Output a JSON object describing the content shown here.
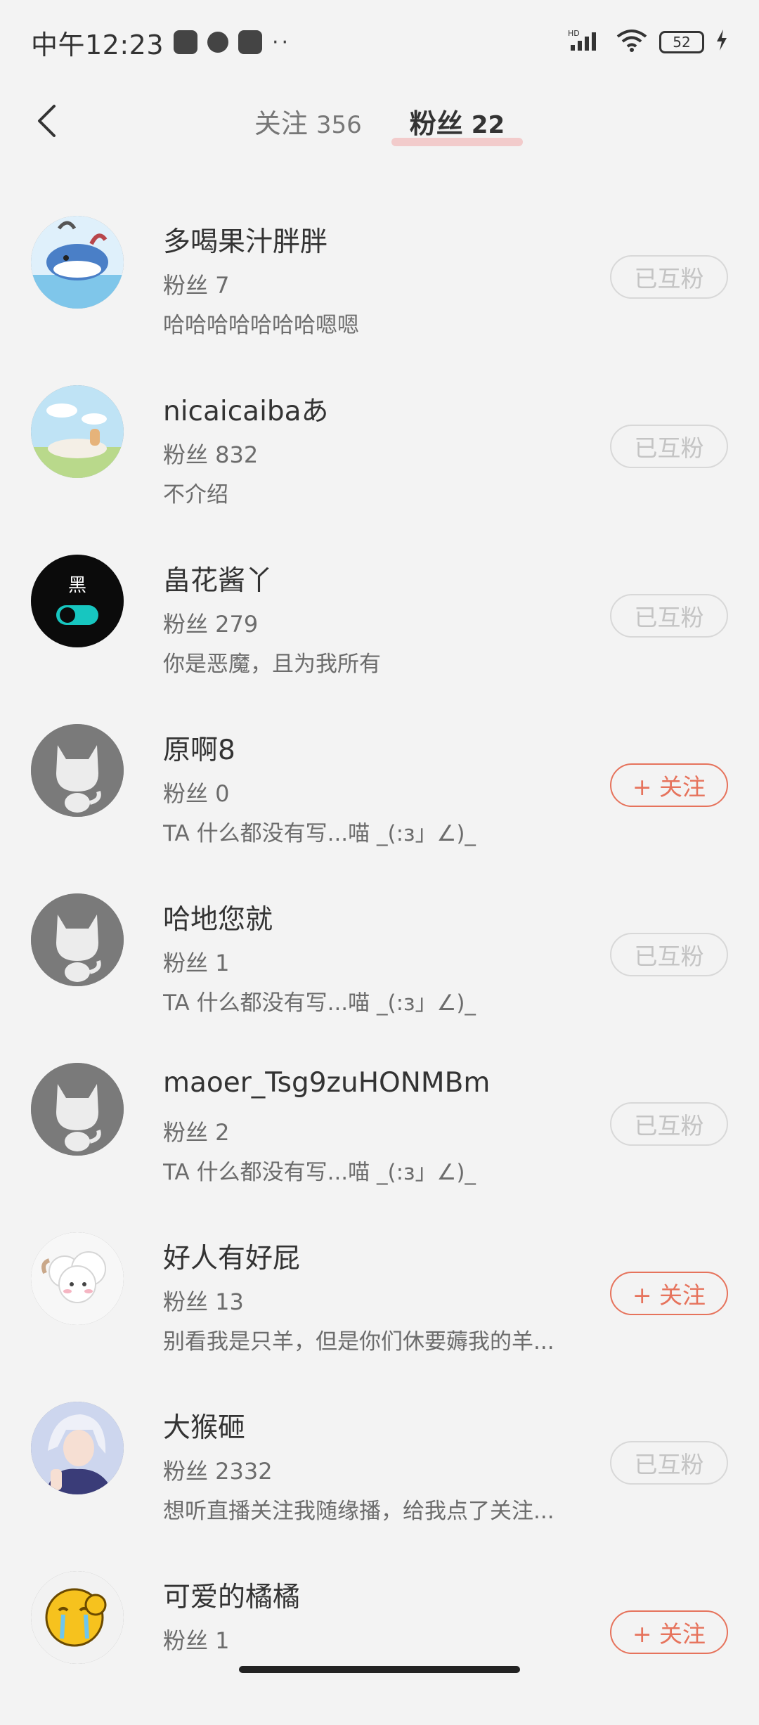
{
  "status_bar": {
    "time": "中午12:23",
    "network_label": "HD",
    "battery_level": "52",
    "dots": "··"
  },
  "header": {
    "tabs": [
      {
        "label": "关注",
        "count": "356"
      },
      {
        "label": "粉丝",
        "count": "22"
      }
    ],
    "active_tab": 1
  },
  "colors": {
    "accent": "#e6735c",
    "mutual_border": "#d8d8d8",
    "tab_underline": "#f2c7c7",
    "background": "#f3f3f3"
  },
  "users": [
    {
      "name": "多喝果汁胖胖",
      "fans": "粉丝 7",
      "bio": "哈哈哈哈哈哈哈嗯嗯",
      "button": "已互粉",
      "state": "mutual",
      "avatar": "whale-avatar"
    },
    {
      "name": "nicaicaibaあ",
      "fans": "粉丝 832",
      "bio": "不介绍",
      "button": "已互粉",
      "state": "mutual",
      "avatar": "scenery-avatar"
    },
    {
      "name": "畠花酱丫",
      "fans": "粉丝 279",
      "bio": "你是恶魔，且为我所有",
      "button": "已互粉",
      "state": "mutual",
      "avatar": "toggle-avatar",
      "avatar_text": "黑"
    },
    {
      "name": "原啊8",
      "fans": "粉丝 0",
      "bio": "TA 什么都没有写...喵 _(:з」∠)_",
      "button": "+ 关注",
      "state": "follow",
      "avatar": "default-cat-avatar"
    },
    {
      "name": "哈地您就",
      "fans": "粉丝 1",
      "bio": "TA 什么都没有写...喵 _(:з」∠)_",
      "button": "已互粉",
      "state": "mutual",
      "avatar": "default-cat-avatar"
    },
    {
      "name": "maoer_Tsg9zuHONMBm",
      "fans": "粉丝 2",
      "bio": "TA 什么都没有写...喵 _(:з」∠)_",
      "button": "已互粉",
      "state": "mutual",
      "avatar": "default-cat-avatar"
    },
    {
      "name": "好人有好屁",
      "fans": "粉丝 13",
      "bio": "别看我是只羊，但是你们休要薅我的羊...",
      "button": "+ 关注",
      "state": "follow",
      "avatar": "sheep-avatar"
    },
    {
      "name": "大猴砸",
      "fans": "粉丝 2332",
      "bio": "想听直播关注我随缘播，给我点了关注...",
      "button": "已互粉",
      "state": "mutual",
      "avatar": "anime-avatar"
    },
    {
      "name": "可爱的橘橘",
      "fans": "粉丝 1",
      "bio": "",
      "button": "+ 关注",
      "state": "follow",
      "avatar": "emoji-avatar"
    }
  ]
}
